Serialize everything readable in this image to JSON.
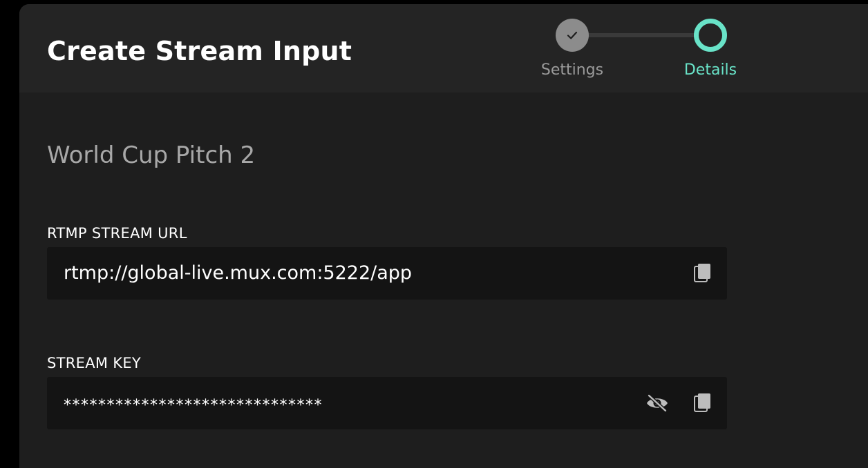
{
  "header": {
    "title": "Create Stream Input"
  },
  "stepper": {
    "steps": [
      {
        "label": "Settings",
        "state": "completed",
        "icon": "check-icon"
      },
      {
        "label": "Details",
        "state": "active"
      }
    ]
  },
  "stream": {
    "name": "World Cup Pitch 2"
  },
  "fields": {
    "rtmp_url": {
      "label": "RTMP STREAM URL",
      "value": "rtmp://global-live.mux.com:5222/app",
      "action_icon": "copy-icon"
    },
    "stream_key": {
      "label": "STREAM KEY",
      "value": "******************************",
      "action_icons": [
        "eye-off-icon",
        "copy-icon"
      ]
    }
  },
  "colors": {
    "accent": "#69e3c8",
    "panel_bg": "#1e1e1e",
    "header_bg": "#242424",
    "field_bg": "#141414",
    "muted_text": "#a8a8a8",
    "completed_step": "#8c8c8c"
  }
}
